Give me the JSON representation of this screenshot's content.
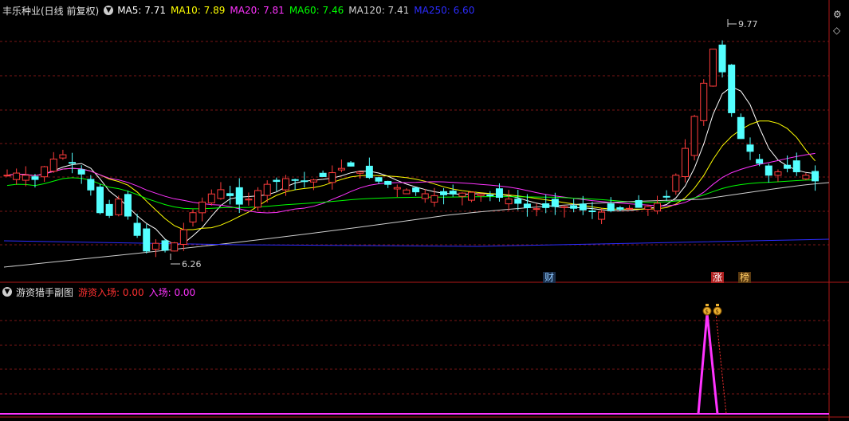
{
  "main_header": {
    "title": "丰乐种业(日线 前复权)",
    "ma": [
      {
        "label": "MA5: 7.71",
        "color": "#ffffff"
      },
      {
        "label": "MA10: 7.89",
        "color": "#ffff00"
      },
      {
        "label": "MA20: 7.81",
        "color": "#ff33ff"
      },
      {
        "label": "MA60: 7.46",
        "color": "#00ff00"
      },
      {
        "label": "MA120: 7.41",
        "color": "#d0d0d0"
      },
      {
        "label": "MA250: 6.60",
        "color": "#2c2cff"
      }
    ]
  },
  "annotations": {
    "high": "9.77",
    "low": "6.26"
  },
  "event_tags": [
    {
      "text": "财",
      "color": "#8ec8ff",
      "bg": "#1a2e4a"
    },
    {
      "text": "涨",
      "color": "#ffffff",
      "bg": "#b02020"
    },
    {
      "text": "榜",
      "color": "#ffcc66",
      "bg": "#5a3a10"
    }
  ],
  "sub_header": {
    "title": "游资猎手副图",
    "items": [
      {
        "label": "游资入场: 0.00",
        "color": "#ff3030"
      },
      {
        "label": "入场: 0.00",
        "color": "#ff33ff"
      }
    ]
  },
  "icons": {
    "collapse": "chevron-down-icon",
    "corner_settings": "gear-icon",
    "corner_toggle": "diamond-icon",
    "signal": "money-bag-icon"
  },
  "colors": {
    "up": "#ff3c3c",
    "down": "#54ffff",
    "grid": "#7a1616",
    "border": "#b01818"
  }
}
